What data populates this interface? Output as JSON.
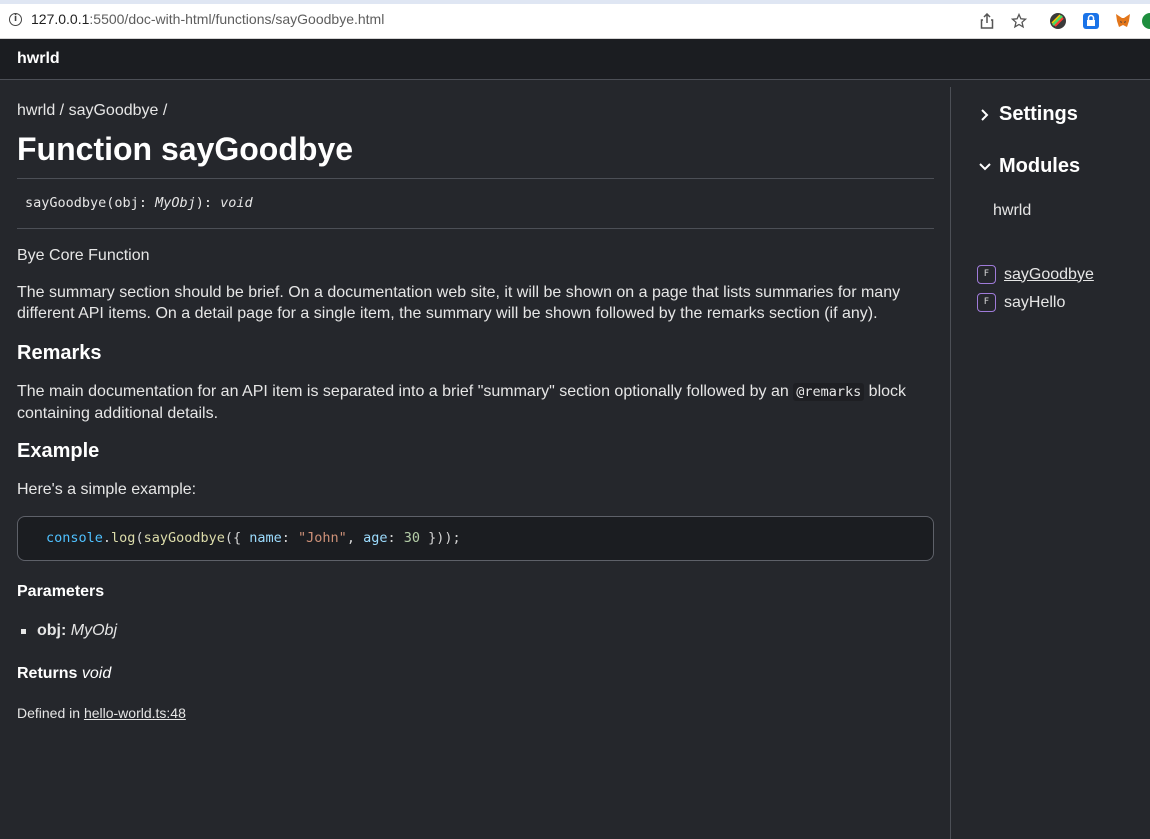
{
  "browser": {
    "url_host": "127.0.0.1",
    "url_rest": ":5500/doc-with-html/functions/sayGoodbye.html"
  },
  "header": {
    "title": "hwrld"
  },
  "main": {
    "breadcrumb": [
      "hwrld",
      "sayGoodbye"
    ],
    "title": "Function sayGoodbye",
    "signature": {
      "name": "sayGoodbye",
      "param": "obj",
      "param_type": "MyObj",
      "return_type": "void"
    },
    "summary_title": "Bye Core Function",
    "summary_text": "The summary section should be brief. On a documentation web site, it will be shown on a page that lists summaries for many different API items. On a detail page for a single item, the summary will be shown followed by the remarks section (if any).",
    "remarks_heading": "Remarks",
    "remarks_before": "The main documentation for an API item is separated into a brief \"summary\" section optionally followed by an ",
    "remarks_code": "@remarks",
    "remarks_after": " block containing additional details.",
    "example_heading": "Example",
    "example_intro": "Here's a simple example:",
    "code": {
      "obj": "console",
      "fn1": "log",
      "fn2": "sayGoodbye",
      "prop1": "name",
      "str1": "\"John\"",
      "prop2": "age",
      "num1": "30"
    },
    "parameters_heading": "Parameters",
    "parameters": [
      {
        "name": "obj",
        "type": "MyObj"
      }
    ],
    "returns_label": "Returns",
    "returns_type": "void",
    "defined_in_label": "Defined in",
    "defined_in_link": "hello-world.ts:48"
  },
  "sidebar": {
    "settings_label": "Settings",
    "modules_label": "Modules",
    "module_name": "hwrld",
    "items": [
      {
        "kind": "F",
        "label": "sayGoodbye",
        "current": true
      },
      {
        "kind": "F",
        "label": "sayHello",
        "current": false
      }
    ]
  }
}
